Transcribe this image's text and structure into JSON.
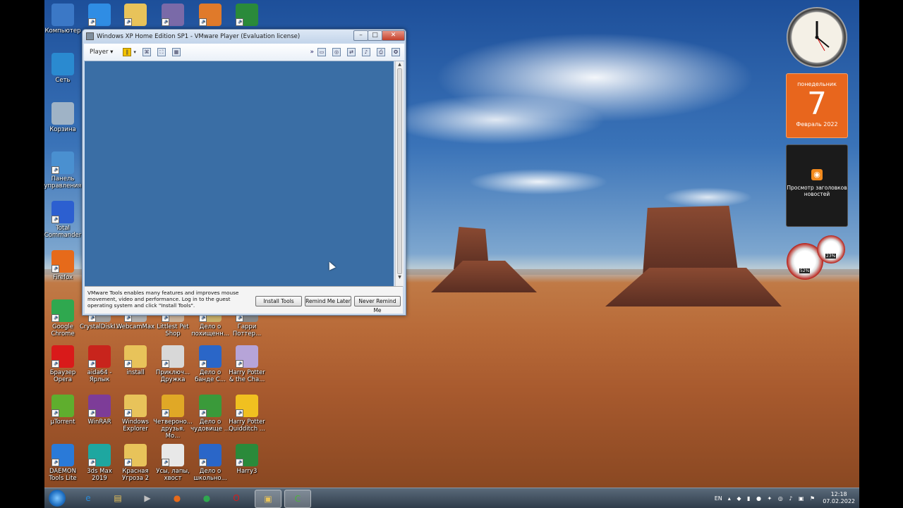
{
  "desktop_icons": [
    {
      "name": "computer-icon",
      "label": "Компьютер",
      "color": "#3b78c6"
    },
    {
      "name": "network-icon",
      "label": "Сеть",
      "color": "#2a8ad0"
    },
    {
      "name": "recycle-bin-icon",
      "label": "Корзина",
      "color": "#9fb3c6"
    },
    {
      "name": "control-panel-icon",
      "label": "Панель управления",
      "color": "#4a90d0"
    },
    {
      "name": "total-commander-icon",
      "label": "Total Commander",
      "color": "#2c5fd0"
    },
    {
      "name": "firefox-icon",
      "label": "Firefox",
      "color": "#e66a1a"
    },
    {
      "name": "chrome-icon",
      "label": "Google Chrome",
      "color": "#2fa84f"
    },
    {
      "name": "opera-icon",
      "label": "Браузер Opera",
      "color": "#d91a1a"
    },
    {
      "name": "utorrent-icon",
      "label": "µTorrent",
      "color": "#5fae2e"
    },
    {
      "name": "daemon-tools-icon",
      "label": "DAEMON Tools Lite",
      "color": "#2a7ad8"
    },
    {
      "name": "app-icon-1",
      "label": "",
      "color": "#2f8de4"
    },
    {
      "name": "crystaldisk-icon",
      "label": "CrystalDiskI...",
      "color": "#a0a0a0"
    },
    {
      "name": "aida64-icon",
      "label": "aida64 - Ярлык",
      "color": "#c8241c"
    },
    {
      "name": "winrar-icon",
      "label": "WinRAR",
      "color": "#7d3c98"
    },
    {
      "name": "3dsmax-icon",
      "label": "3ds Max 2019",
      "color": "#1ea7a0"
    },
    {
      "name": "folder-icon",
      "label": "",
      "color": "#e8c35a"
    },
    {
      "name": "webcammax-icon",
      "label": "WebcamMax",
      "color": "#b0b0b0"
    },
    {
      "name": "install-folder-icon",
      "label": "install",
      "color": "#e8c35a"
    },
    {
      "name": "windows-explorer-icon",
      "label": "Windows Explorer",
      "color": "#e8c35a"
    },
    {
      "name": "krasnaya-ugroza-icon",
      "label": "Красная Угроза 2",
      "color": "#e8c35a"
    },
    {
      "name": "app-icon-2",
      "label": "",
      "color": "#7a6aa8"
    },
    {
      "name": "littlest-pet-shop-icon",
      "label": "Littlest Pet Shop",
      "color": "#c9b199"
    },
    {
      "name": "priklyucheniya-druzhka-icon",
      "label": "Приключ... Дружка",
      "color": "#d8d8d8"
    },
    {
      "name": "chetveronogie-druzya-icon",
      "label": "Четвероно... друзья. Мо...",
      "color": "#e0a826"
    },
    {
      "name": "usy-lapy-hvost-icon",
      "label": "Усы, лапы, хвост",
      "color": "#e8e8e8"
    },
    {
      "name": "app-icon-3",
      "label": "",
      "color": "#e07a2a"
    },
    {
      "name": "delo-o-pohishchennom-icon",
      "label": "Дело о похищенн...",
      "color": "#c8b06a"
    },
    {
      "name": "delo-o-bande-icon",
      "label": "Дело о банде С...",
      "color": "#2a66c8"
    },
    {
      "name": "delo-o-chudovishche-icon",
      "label": "Дело о чудовище ...",
      "color": "#3a9a3a"
    },
    {
      "name": "delo-o-shkolnom-icon",
      "label": "Дело о школьно...",
      "color": "#2a66c8"
    },
    {
      "name": "app-icon-4",
      "label": "",
      "color": "#2a8a3a"
    },
    {
      "name": "harry-potter-icon",
      "label": "Гарри Поттер...",
      "color": "#888"
    },
    {
      "name": "harry-potter-chamber-icon",
      "label": "Harry Potter & the Cha...",
      "color": "#b6a4d8"
    },
    {
      "name": "harry-potter-quidditch-icon",
      "label": "Harry Potter Quidditch ...",
      "color": "#f0c020"
    },
    {
      "name": "harry3-icon",
      "label": "Harry3",
      "color": "#2a8a3a"
    }
  ],
  "gadgets": {
    "calendar": {
      "weekday": "понедельник",
      "day": "7",
      "month_year": "Февраль 2022"
    },
    "feeds": {
      "label": "Просмотр заголовков новостей"
    },
    "meter": {
      "cpu": "52%",
      "ram": "23%"
    }
  },
  "vmware": {
    "title": "Windows XP Home Edition SP1 - VMware Player (Evaluation license)",
    "menu_label": "Player",
    "hint_message": "VMware Tools enables many features and improves mouse movement, video and performance. Log in to the guest operating system and click \"Install Tools\".",
    "buttons": {
      "install": "Install Tools",
      "remind": "Remind Me Later",
      "never": "Never Remind Me"
    }
  },
  "taskbar": {
    "items": [
      {
        "name": "taskbar-ie",
        "glyph": "e",
        "color": "#2a8ad8"
      },
      {
        "name": "taskbar-explorer",
        "glyph": "▤",
        "color": "#e8c35a"
      },
      {
        "name": "taskbar-media",
        "glyph": "▶",
        "color": "#c0c0c0"
      },
      {
        "name": "taskbar-firefox",
        "glyph": "●",
        "color": "#e66a1a"
      },
      {
        "name": "taskbar-chrome",
        "glyph": "●",
        "color": "#2fa84f"
      },
      {
        "name": "taskbar-opera",
        "glyph": "O",
        "color": "#d91a1a"
      },
      {
        "name": "taskbar-vmware",
        "glyph": "▣",
        "color": "#e8c35a"
      },
      {
        "name": "taskbar-camtasia",
        "glyph": "C",
        "color": "#4bb43a"
      }
    ],
    "language": "EN",
    "time": "12:18",
    "date": "07.02.2022"
  }
}
